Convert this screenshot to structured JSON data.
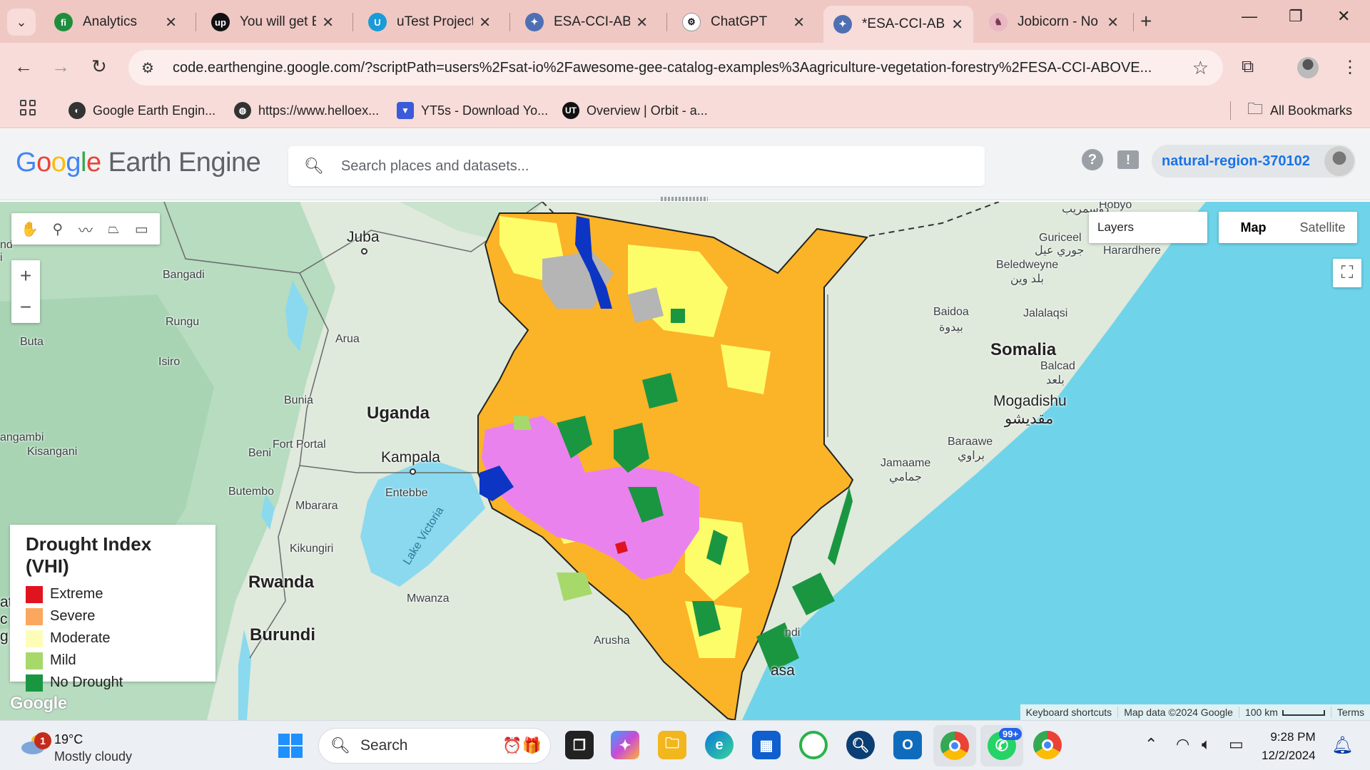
{
  "browser": {
    "tabs": [
      {
        "title": "Analytics",
        "icon": "analytics-favicon",
        "color": "#1e8e3e",
        "glyph": "fi"
      },
      {
        "title": "You will get Bl",
        "icon": "upwork-favicon",
        "color": "#111111",
        "glyph": "up"
      },
      {
        "title": "uTest Projects",
        "icon": "utest-favicon",
        "color": "#1a9bd7",
        "glyph": "U"
      },
      {
        "title": "ESA-CCI-ABOV",
        "icon": "earth-engine-favicon",
        "color": "#4f6fb3",
        "glyph": "✦"
      },
      {
        "title": "ChatGPT",
        "icon": "chatgpt-favicon",
        "color": "#ffffff",
        "glyph": "⚙"
      },
      {
        "title": "*ESA-CCI-ABO",
        "icon": "earth-engine-favicon",
        "color": "#4f6fb3",
        "glyph": "✦"
      },
      {
        "title": "Jobicorn - No",
        "icon": "jobicorn-favicon",
        "color": "#e9b8c4",
        "glyph": "♞"
      }
    ],
    "active_tab_index": 5,
    "url": "code.earthengine.google.com/?scriptPath=users%2Fsat-io%2Fawesome-gee-catalog-examples%3Aagriculture-vegetation-forestry%2FESA-CCI-ABOVE...",
    "bookmarks": [
      {
        "label": "Google Earth Engin...",
        "icon": "earth-engine-bookmark-icon"
      },
      {
        "label": "https://www.helloex...",
        "icon": "globe-bookmark-icon"
      },
      {
        "label": "YT5s - Download Yo...",
        "icon": "yt5s-bookmark-icon"
      },
      {
        "label": "Overview | Orbit - a...",
        "icon": "orbit-bookmark-icon"
      }
    ],
    "all_bookmarks_label": "All Bookmarks"
  },
  "gee": {
    "logo_google": "Google",
    "logo_product": "Earth Engine",
    "search_placeholder": "Search places and datasets...",
    "project_name": "natural-region-370102"
  },
  "map": {
    "layers_label": "Layers",
    "map_type_options": [
      "Map",
      "Satellite"
    ],
    "selected_map_type": "Map",
    "labels": {
      "juba": "Juba",
      "bangadi": "Bangadi",
      "rungu": "Rungu",
      "buta": "Buta",
      "isiro": "Isiro",
      "arua": "Arua",
      "bunia": "Bunia",
      "uganda": "Uganda",
      "kampala": "Kampala",
      "entebbe": "Entebbe",
      "beni": "Beni",
      "fort_portal": "Fort Portal",
      "butembo": "Butembo",
      "mbarara": "Mbarara",
      "kikungiri": "Kikungiri",
      "rwanda": "Rwanda",
      "burundi": "Burundi",
      "mwanza": "Mwanza",
      "arusha": "Arusha",
      "kisangani": "Kisangani",
      "angambi": "angambi",
      "lake_victoria": "Lake Victoria",
      "somalia": "Somalia",
      "mogadishu": "Mogadishu",
      "mogadishu_ar": "مقديشو",
      "baidoa": "Baidoa",
      "baidoa_ar": "بيدوة",
      "beledweyne": "Beledweyne",
      "beledweyne_ar": "بلد وين",
      "jalalaqsi": "Jalalaqsi",
      "guriceel": "Guriceel",
      "guriceel_ar": "جوري عيل",
      "harardhere": "Harardhere",
      "balcad": "Balcad",
      "balcad_ar": "بلعد",
      "baraawe": "Baraawe",
      "baraawe_ar": "براوي",
      "jamaame": "Jamaame",
      "jamaame_ar": "جمامي",
      "hobyo": "Hobyo",
      "dusamareb_ar": "دوسمريب",
      "asa": "asa",
      "ndi": "ndi",
      "nd": "nd",
      "i": "i",
      "at": "at",
      "c": "c",
      "g": "g"
    },
    "legend": {
      "title": "Drought Index (VHI)",
      "items": [
        {
          "label": "Extreme",
          "color": "#e0141e"
        },
        {
          "label": "Severe",
          "color": "#fba75e"
        },
        {
          "label": "Moderate",
          "color": "#fdfdb8"
        },
        {
          "label": "Mild",
          "color": "#a6d96a"
        },
        {
          "label": "No Drought",
          "color": "#1a9641"
        }
      ]
    },
    "attribution": {
      "keyboard": "Keyboard shortcuts",
      "map_data": "Map data ©2024 Google",
      "scale": "100 km",
      "terms": "Terms"
    },
    "watermark": "Google"
  },
  "taskbar": {
    "weather_temp": "19°C",
    "weather_condition": "Mostly cloudy",
    "weather_badge": "1",
    "search_label": "Search",
    "whatsapp_badge": "99+",
    "time": "9:28 PM",
    "date": "12/2/2024"
  }
}
